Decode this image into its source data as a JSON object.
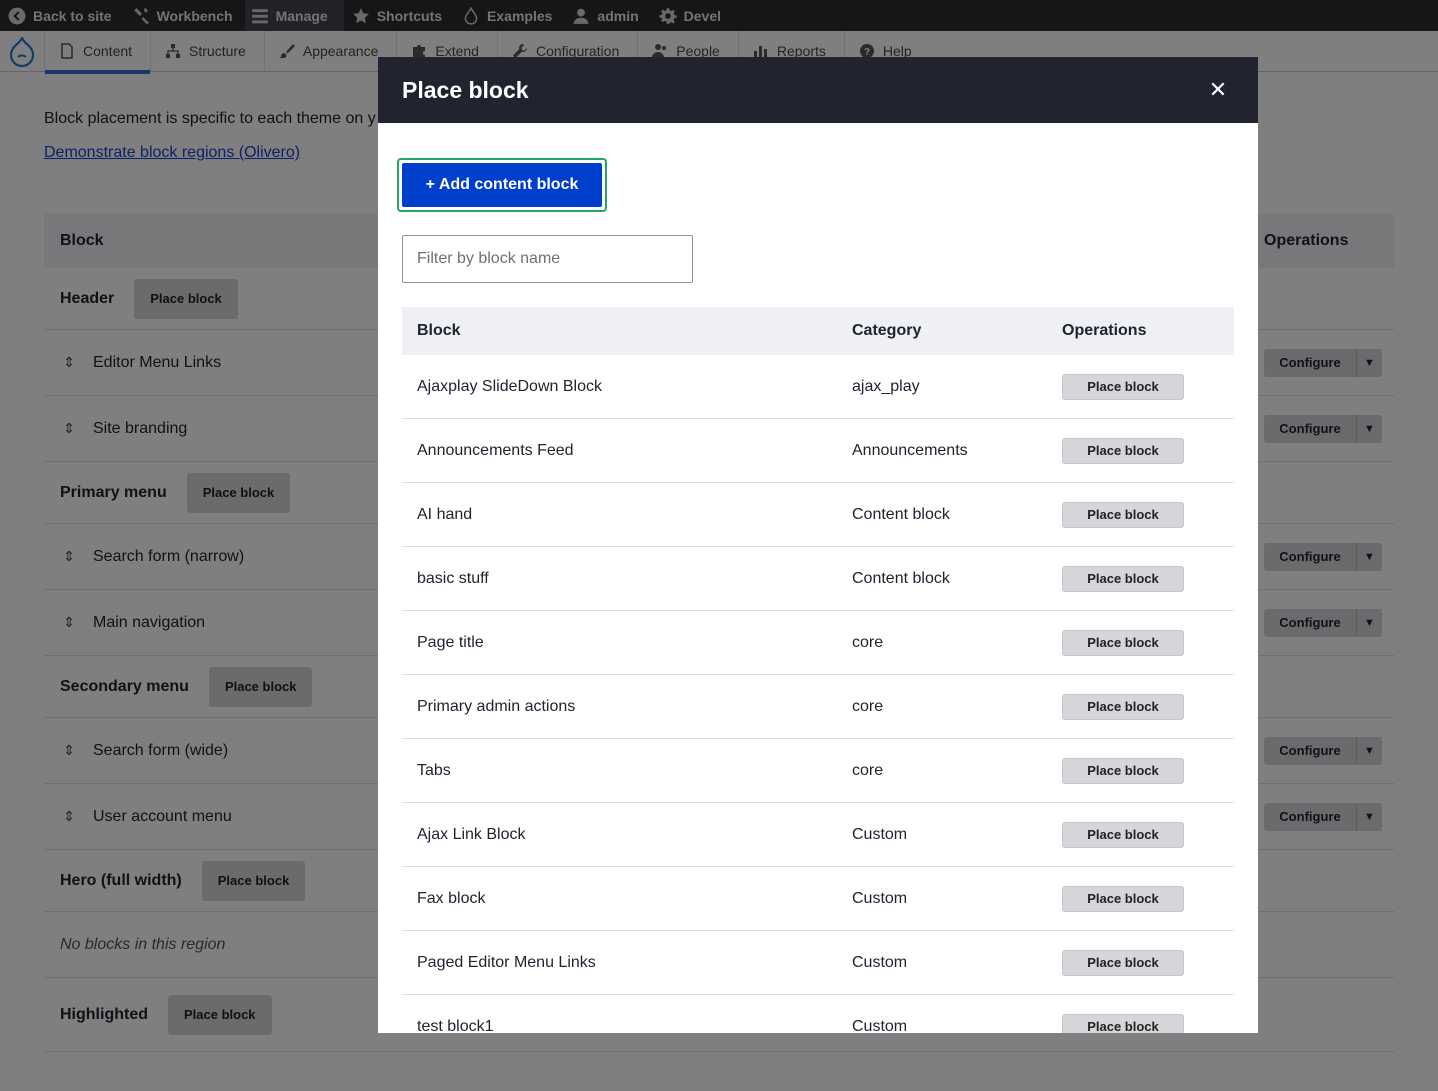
{
  "toolbar": {
    "items": [
      {
        "label": "Back to site",
        "icon": "chevron-left-circle-icon"
      },
      {
        "label": "Workbench",
        "icon": "tools-icon"
      },
      {
        "label": "Manage",
        "icon": "hamburger-icon"
      },
      {
        "label": "Shortcuts",
        "icon": "star-icon"
      },
      {
        "label": "Examples",
        "icon": "droplet-icon"
      },
      {
        "label": "admin",
        "icon": "user-icon"
      },
      {
        "label": "Devel",
        "icon": "gear-icon"
      }
    ]
  },
  "tray": {
    "items": [
      {
        "label": "Content",
        "icon": "document-icon"
      },
      {
        "label": "Structure",
        "icon": "structure-icon"
      },
      {
        "label": "Appearance",
        "icon": "brush-icon"
      },
      {
        "label": "Extend",
        "icon": "puzzle-icon"
      },
      {
        "label": "Configuration",
        "icon": "wrench-icon"
      },
      {
        "label": "People",
        "icon": "people-icon"
      },
      {
        "label": "Reports",
        "icon": "bar-chart-icon"
      },
      {
        "label": "Help",
        "icon": "help-icon"
      }
    ]
  },
  "page": {
    "intro": "Block placement is specific to each theme on y",
    "demo_link": "Demonstrate block regions (Olivero)",
    "table_headers": {
      "block": "Block",
      "operations": "Operations"
    },
    "place_label": "Place block",
    "configure_label": "Configure",
    "regions": [
      {
        "name": "Header",
        "rows": [
          "Editor Menu Links",
          "Site branding"
        ]
      },
      {
        "name": "Primary menu",
        "rows": [
          "Search form (narrow)",
          "Main navigation"
        ]
      },
      {
        "name": "Secondary menu",
        "rows": [
          "Search form (wide)",
          "User account menu"
        ]
      },
      {
        "name": "Hero (full width)",
        "empty": "No blocks in this region"
      },
      {
        "name": "Highlighted",
        "rows": []
      }
    ]
  },
  "dialog": {
    "title": "Place block",
    "close_icon": "close-icon",
    "add_button": "+ Add content block",
    "filter_placeholder": "Filter by block name",
    "headers": {
      "block": "Block",
      "category": "Category",
      "operations": "Operations"
    },
    "place_label": "Place block",
    "rows": [
      {
        "block": "Ajaxplay SlideDown Block",
        "category": "ajax_play"
      },
      {
        "block": "Announcements Feed",
        "category": "Announcements"
      },
      {
        "block": "AI hand",
        "category": "Content block"
      },
      {
        "block": "basic stuff",
        "category": "Content block"
      },
      {
        "block": "Page title",
        "category": "core"
      },
      {
        "block": "Primary admin actions",
        "category": "core"
      },
      {
        "block": "Tabs",
        "category": "core"
      },
      {
        "block": "Ajax Link Block",
        "category": "Custom"
      },
      {
        "block": "Fax block",
        "category": "Custom"
      },
      {
        "block": "Paged Editor Menu Links",
        "category": "Custom"
      },
      {
        "block": "test block1",
        "category": "Custom"
      }
    ]
  }
}
